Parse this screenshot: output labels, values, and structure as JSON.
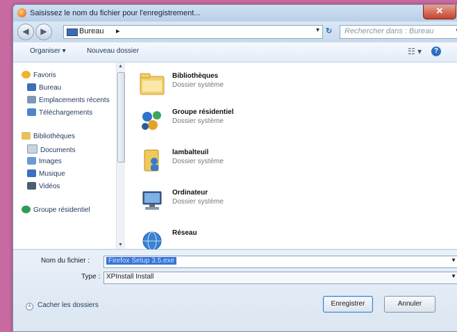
{
  "window": {
    "title": "Saisissez le nom du fichier pour l'enregistrement...",
    "close_glyph": "✕"
  },
  "navbar": {
    "back_glyph": "◀",
    "forward_glyph": "▶",
    "address": "Bureau",
    "address_sep": "▸",
    "address_dropdown": "▾",
    "refresh_glyph": "↻",
    "search_placeholder": "Rechercher dans : Bureau",
    "search_glyph": "⚲"
  },
  "toolbar": {
    "organize": "Organiser ▾",
    "new_folder": "Nouveau dossier",
    "view_glyph": "☷ ▾",
    "help_glyph": "?"
  },
  "nav_pane": {
    "items": [
      {
        "label": "Favoris",
        "icon": "star-icon",
        "color": "#f0b428"
      },
      {
        "label": "Bureau",
        "icon": "desktop-icon",
        "color": "#3e6fb5"
      },
      {
        "label": "Emplacements récents",
        "icon": "recent-places-icon",
        "color": "#7f98b8"
      },
      {
        "label": "Téléchargements",
        "icon": "downloads-icon",
        "color": "#4f86c9"
      },
      {
        "label": "Bibliothèques",
        "icon": "libraries-icon",
        "color": "#e8c15a"
      },
      {
        "label": "Documents",
        "icon": "documents-icon",
        "color": "#c9d4e2"
      },
      {
        "label": "Images",
        "icon": "images-icon",
        "color": "#6a9bd6"
      },
      {
        "label": "Musique",
        "icon": "music-icon",
        "color": "#3a70c1"
      },
      {
        "label": "Vidéos",
        "icon": "videos-icon",
        "color": "#4d5d73"
      },
      {
        "label": "Groupe résidentiel",
        "icon": "homegroup-icon",
        "color": "#2f9a5a"
      }
    ]
  },
  "content": {
    "items": [
      {
        "name": "Bibliothèques",
        "sub": "Dossier système",
        "icon": "libraries-folder-icon"
      },
      {
        "name": "Groupe résidentiel",
        "sub": "Dossier système",
        "icon": "homegroup-icon"
      },
      {
        "name": "lambalteuil",
        "sub": "Dossier système",
        "icon": "user-folder-icon"
      },
      {
        "name": "Ordinateur",
        "sub": "Dossier système",
        "icon": "computer-icon"
      },
      {
        "name": "Réseau",
        "sub": "",
        "icon": "network-icon"
      }
    ]
  },
  "save_form": {
    "filename_label": "Nom du fichier :",
    "filename_value": "Firefox Setup 3.5.exe",
    "type_label": "Type :",
    "type_value": "XPInstall Install",
    "dropdown_glyph": "▼",
    "hide_folders": "Cacher les dossiers",
    "save_button": "Enregistrer",
    "cancel_button": "Annuler"
  }
}
